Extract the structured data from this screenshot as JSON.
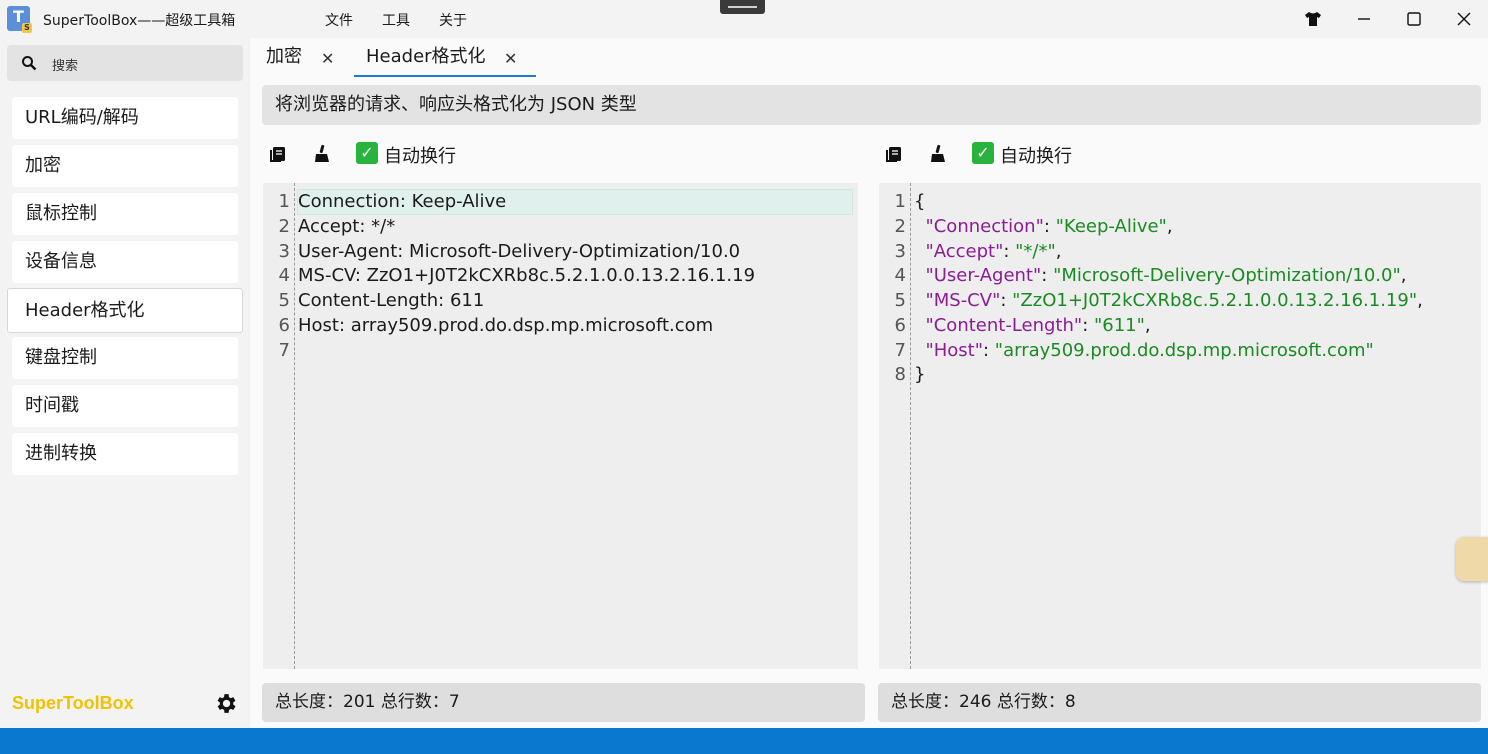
{
  "window": {
    "title": "SuperToolBox——超级工具箱",
    "menu": [
      "文件",
      "工具",
      "关于"
    ]
  },
  "sidebar": {
    "search_placeholder": "搜索",
    "items": [
      {
        "label": "URL编码/解码"
      },
      {
        "label": "加密"
      },
      {
        "label": "鼠标控制"
      },
      {
        "label": "设备信息"
      },
      {
        "label": "Header格式化",
        "active": true
      },
      {
        "label": "键盘控制"
      },
      {
        "label": "时间戳"
      },
      {
        "label": "进制转换"
      }
    ],
    "brand": "SuperToolBox"
  },
  "tabs": [
    {
      "label": "加密"
    },
    {
      "label": "Header格式化",
      "active": true
    }
  ],
  "description": "将浏览器的请求、响应头格式化为 JSON 类型",
  "left_panel": {
    "wrap_label": "自动换行",
    "line_numbers": [
      "1",
      "2",
      "3",
      "4",
      "5",
      "6",
      "7"
    ],
    "lines": [
      "Connection: Keep-Alive",
      "Accept: */*",
      "User-Agent: Microsoft-Delivery-Optimization/10.0",
      "MS-CV: ZzO1+J0T2kCXRb8c.5.2.1.0.0.13.2.16.1.19",
      "Content-Length: 611",
      "Host: array509.prod.do.dsp.mp.microsoft.com",
      ""
    ],
    "status": "总长度：201 总行数：7"
  },
  "right_panel": {
    "wrap_label": "自动换行",
    "line_numbers": [
      "1",
      "2",
      "3",
      "4",
      "5",
      "6",
      "7",
      "8"
    ],
    "open_brace": "{",
    "close_brace": "}",
    "entries": [
      {
        "key": "\"Connection\"",
        "sep": ": ",
        "value": "\"Keep-Alive\"",
        "comma": ","
      },
      {
        "key": "\"Accept\"",
        "sep": ": ",
        "value": "\"*/*\"",
        "comma": ","
      },
      {
        "key": "\"User-Agent\"",
        "sep": ": ",
        "value": "\"Microsoft-Delivery-Optimization/10.0\"",
        "comma": ","
      },
      {
        "key": "\"MS-CV\"",
        "sep": ": ",
        "value": "\"ZzO1+J0T2kCXRb8c.5.2.1.0.0.13.2.16.1.19\"",
        "comma": ","
      },
      {
        "key": "\"Content-Length\"",
        "sep": ": ",
        "value": "\"611\"",
        "comma": ","
      },
      {
        "key": "\"Host\"",
        "sep": ": ",
        "value": "\"array509.prod.do.dsp.mp.microsoft.com\"",
        "comma": ""
      }
    ],
    "status": "总长度：246 总行数：8"
  },
  "colors": {
    "accent": "#1f7ad6",
    "brand": "#f2c200",
    "json_key": "#8a1d96",
    "json_value": "#1a8a22",
    "checkbox": "#28b43c",
    "bottom_bar": "#0b78cf"
  },
  "icons": [
    "app-logo",
    "tshirt-icon",
    "minimize-icon",
    "maximize-icon",
    "close-icon",
    "search-icon",
    "copy-icon",
    "broom-icon",
    "checkbox-checked-icon",
    "gear-icon"
  ]
}
